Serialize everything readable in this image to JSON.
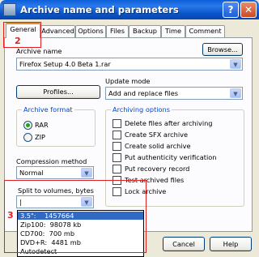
{
  "window": {
    "title": "Archive name and parameters",
    "help_glyph": "?",
    "close_glyph": "✕"
  },
  "tabs": [
    "General",
    "Advanced",
    "Options",
    "Files",
    "Backup",
    "Time",
    "Comment"
  ],
  "annotations": {
    "n2": "2",
    "n3": "3"
  },
  "archive": {
    "name_label": "Archive name",
    "name_value": "Firefox Setup 4.0 Beta 1.rar",
    "browse_label": "Browse...",
    "profiles_label": "Profiles...",
    "update_label": "Update mode",
    "update_value": "Add and replace files"
  },
  "format": {
    "title": "Archive format",
    "options": [
      "RAR",
      "ZIP"
    ],
    "selected": "RAR"
  },
  "compression": {
    "label": "Compression method",
    "value": "Normal"
  },
  "split": {
    "label": "Split to volumes, bytes",
    "value": "|",
    "options": [
      "3.5\":    1457664",
      "Zip100:  98078 kb",
      "CD700:  700 mb",
      "DVD+R:  4481 mb",
      "Autodetect"
    ]
  },
  "archiving_options": {
    "title": "Archiving options",
    "items": [
      "Delete files after archiving",
      "Create SFX archive",
      "Create solid archive",
      "Put authenticity verification",
      "Put recovery record",
      "Test archived files",
      "Lock archive"
    ]
  },
  "buttons": {
    "cancel": "Cancel",
    "help": "Help"
  }
}
